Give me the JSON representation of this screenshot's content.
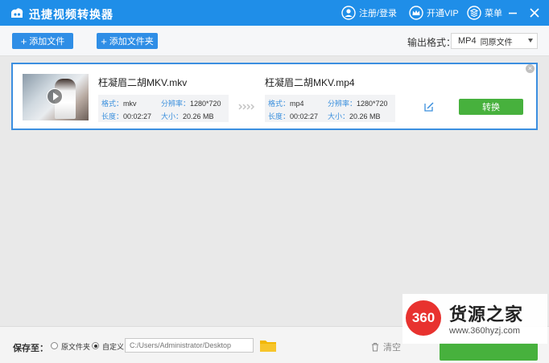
{
  "app": {
    "title": "迅捷视频转换器",
    "accent_color": "#1f8ee8"
  },
  "titlebar": {
    "login_label": "注册/登录",
    "login_icon": "user-icon",
    "vip_label": "开通VIP",
    "vip_icon": "crown-icon",
    "menu_label": "菜单",
    "menu_icon": "menu-icon",
    "minimize_icon": "minimize-icon",
    "close_icon": "close-icon"
  },
  "toolbar": {
    "add_file_label": "添加文件",
    "add_folder_label": "添加文件夹",
    "output_format_label": "输出格式：",
    "output_format_value": "MP4",
    "output_format_sub": "同原文件"
  },
  "file_item": {
    "source": {
      "name": "枉凝眉二胡MKV.mkv",
      "format_key": "格式：",
      "format": "mkv",
      "resolution_key": "分辨率：",
      "resolution": "1280*720",
      "duration_key": "长度：",
      "duration": "00:02:27",
      "size_key": "大小：",
      "size": "20.26 MB"
    },
    "target": {
      "name": "枉凝眉二胡MKV.mp4",
      "format_key": "格式：",
      "format": "mp4",
      "resolution_key": "分辨率：",
      "resolution": "1280*720",
      "duration_key": "长度：",
      "duration": "00:02:27",
      "size_key": "大小：",
      "size": "20.26 MB"
    },
    "convert_label": "转换",
    "convert_color": "#47b13d"
  },
  "bottom": {
    "save_to_label": "保存至：",
    "option_source": "原文件夹",
    "option_custom": "自定义",
    "path_placeholder": "C:/Users/Administrator/Desktop",
    "clear_label": "清空"
  },
  "watermark": {
    "badge": "360",
    "text": "货源之家",
    "url": "www.360hyzj.com"
  }
}
